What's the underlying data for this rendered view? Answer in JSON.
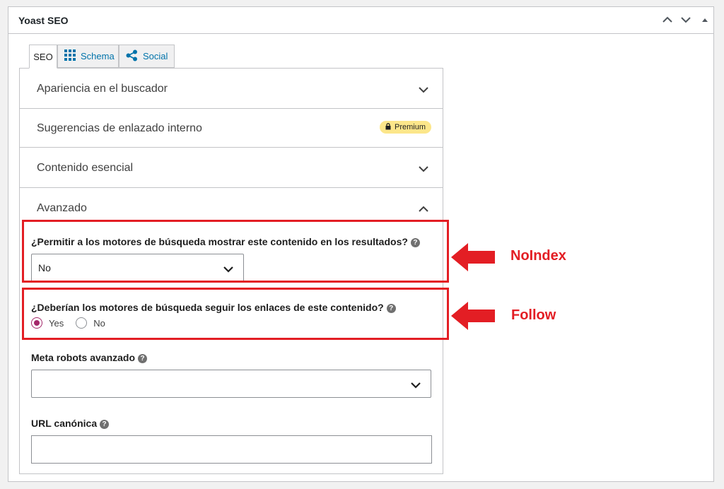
{
  "metabox": {
    "title": "Yoast SEO",
    "controls": [
      "chevron-up-icon",
      "chevron-down-icon",
      "caret-up-icon"
    ]
  },
  "tabs": [
    {
      "label": "SEO",
      "icon": null,
      "active": true
    },
    {
      "label": "Schema",
      "icon": "grid-icon",
      "active": false
    },
    {
      "label": "Social",
      "icon": "share-icon",
      "active": false
    }
  ],
  "accordion": [
    {
      "label": "Apariencia en el buscador",
      "state": "collapsed"
    },
    {
      "label": "Sugerencias de enlazado interno",
      "badge": "Premium",
      "badge_icon": "lock-icon"
    },
    {
      "label": "Contenido esencial",
      "state": "collapsed"
    },
    {
      "label": "Avanzado",
      "state": "expanded"
    }
  ],
  "advanced": {
    "index_question": "¿Permitir a los motores de búsqueda mostrar este contenido en los resultados?",
    "index_value": "No",
    "follow_question": "¿Deberían los motores de búsqueda seguir los enlaces de este contenido?",
    "follow_options": [
      {
        "label": "Yes",
        "checked": true
      },
      {
        "label": "No",
        "checked": false
      }
    ],
    "meta_robots_label": "Meta robots avanzado",
    "meta_robots_value": "",
    "canonical_label": "URL canónica",
    "canonical_value": ""
  },
  "annotations": {
    "noindex": "NoIndex",
    "follow": "Follow",
    "color": "#e31e24"
  },
  "colors": {
    "accent": "#a4286a",
    "link": "#0073aa",
    "premium_badge": "#fce68a"
  }
}
